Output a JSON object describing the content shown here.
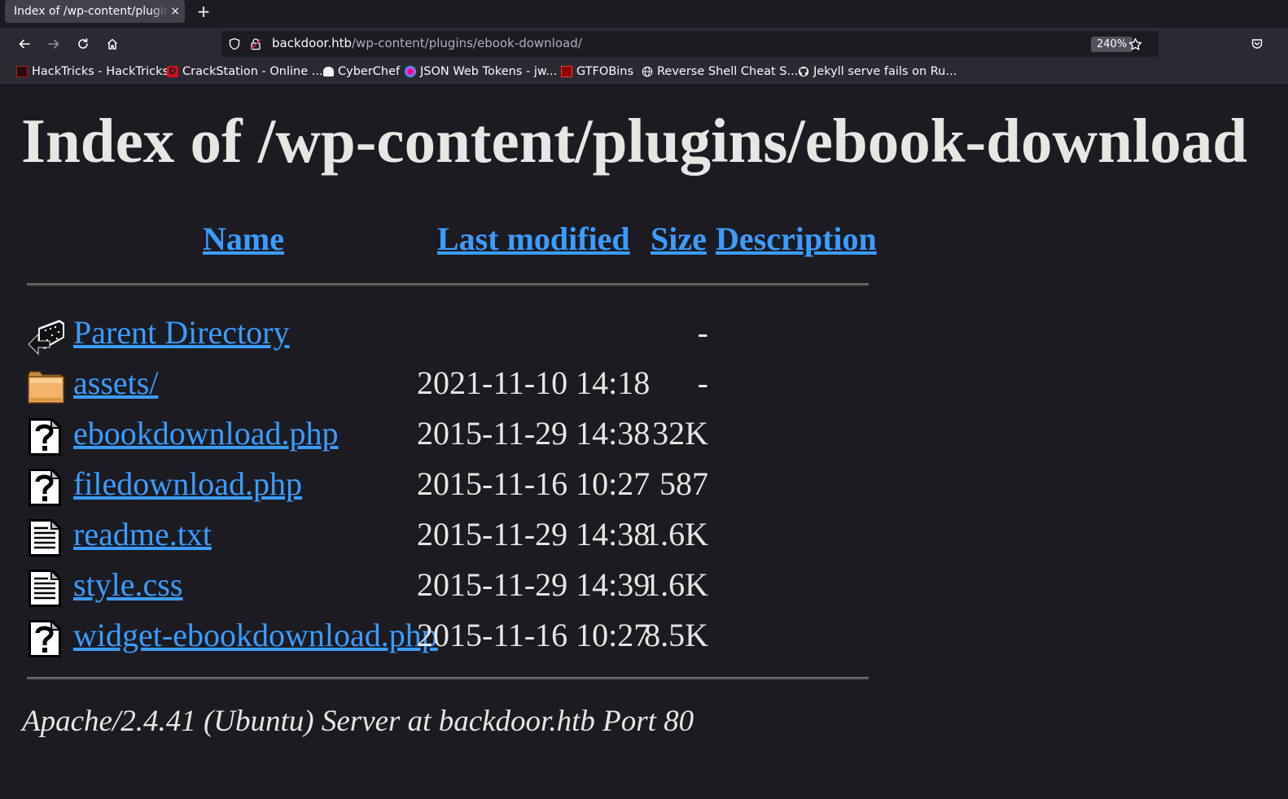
{
  "browser": {
    "tab_title": "Index of /wp-content/plugins/ebook-download/",
    "tab_close": "×",
    "new_tab": "+",
    "url_host": "backdoor.htb",
    "url_path": "/wp-content/plugins/ebook-download/",
    "zoom": "240%",
    "bookmarks": [
      {
        "label": "HackTricks - HackTricks",
        "icon": "hacktricks-icon"
      },
      {
        "label": "CrackStation - Online ...",
        "icon": "crackstation-icon"
      },
      {
        "label": "CyberChef",
        "icon": "cyberchef-icon"
      },
      {
        "label": "JSON Web Tokens - jw...",
        "icon": "jwt-icon"
      },
      {
        "label": "GTFOBins",
        "icon": "gtfobins-icon"
      },
      {
        "label": "Reverse Shell Cheat S...",
        "icon": "globe-icon"
      },
      {
        "label": "Jekyll serve fails on Ru...",
        "icon": "github-icon"
      }
    ]
  },
  "page": {
    "title": "Index of /wp-content/plugins/ebook-download",
    "columns": {
      "name": "Name",
      "last_modified": "Last modified",
      "size": "Size",
      "description": "Description"
    },
    "entries": [
      {
        "name": "Parent Directory",
        "date": "",
        "size": "-",
        "icon": "back-arrow-icon"
      },
      {
        "name": "assets/",
        "date": "2021-11-10 14:18",
        "size": "-",
        "icon": "folder-icon"
      },
      {
        "name": "ebookdownload.php",
        "date": "2015-11-29 14:38",
        "size": "32K",
        "icon": "unknown-file-icon"
      },
      {
        "name": "filedownload.php",
        "date": "2015-11-16 10:27",
        "size": "587",
        "icon": "unknown-file-icon"
      },
      {
        "name": "readme.txt",
        "date": "2015-11-29 14:38",
        "size": "1.6K",
        "icon": "text-file-icon"
      },
      {
        "name": "style.css",
        "date": "2015-11-29 14:39",
        "size": "1.6K",
        "icon": "text-file-icon"
      },
      {
        "name": "widget-ebookdownload.php",
        "date": "2015-11-16 10:27",
        "size": "8.5K",
        "icon": "unknown-file-icon"
      }
    ],
    "footer": "Apache/2.4.41 (Ubuntu) Server at backdoor.htb Port 80"
  },
  "colors": {
    "link": "#3b9cff",
    "background": "#1c1b22",
    "text": "#e8e6e3"
  }
}
